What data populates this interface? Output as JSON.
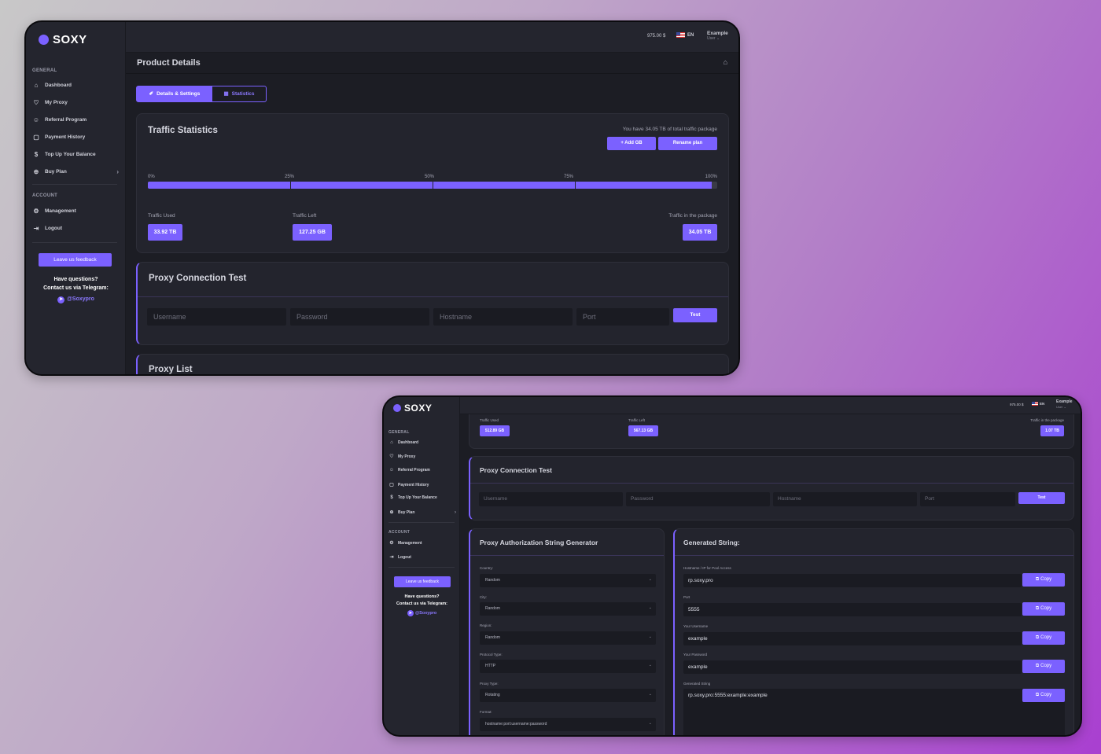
{
  "brand": {
    "name": "SOXY",
    "accent": "#7b61ff"
  },
  "sidebar": {
    "general_label": "GENERAL",
    "account_label": "ACCOUNT",
    "items": [
      {
        "label": "Dashboard",
        "icon": "home-icon"
      },
      {
        "label": "My Proxy",
        "icon": "shield-icon"
      },
      {
        "label": "Referral Program",
        "icon": "users-icon"
      },
      {
        "label": "Payment History",
        "icon": "receipt-icon"
      },
      {
        "label": "Top Up Your Balance",
        "icon": "dollar-icon"
      },
      {
        "label": "Buy Plan",
        "icon": "globe-icon"
      }
    ],
    "account_items": [
      {
        "label": "Management",
        "icon": "gear-icon"
      },
      {
        "label": "Logout",
        "icon": "logout-icon"
      }
    ],
    "feedback": "Leave us feedback",
    "help_line1": "Have questions?",
    "help_line2": "Contact us via Telegram:",
    "telegram_top": "@Soxypro",
    "telegram_bottom": "@Soxypro"
  },
  "topbar": {
    "balance": "975.00 $",
    "lang": "EN",
    "user_name": "Example",
    "user_role": "User ⌄"
  },
  "win1": {
    "page_title": "Product Details",
    "tabs": [
      "Details & Settings",
      "Statistics"
    ],
    "traffic": {
      "title": "Traffic Statistics",
      "note": "You have 34.05 TB of total traffic package",
      "add_gb": "+ Add GB",
      "rename": "Rename plan",
      "ticks": [
        "0%",
        "25%",
        "50%",
        "75%",
        "100%"
      ],
      "progress_fraction": 0.99,
      "used_label": "Traffic Used",
      "used": "33.92 TB",
      "left_label": "Traffic Left",
      "left": "127.25 GB",
      "package_label": "Traffic in the package",
      "package": "34.05 TB"
    },
    "conn": {
      "title": "Proxy Connection Test",
      "username_ph": "Username",
      "password_ph": "Password",
      "hostname_ph": "Hostname",
      "port_ph": "Port",
      "test": "Test"
    },
    "proxy_list_title": "Proxy List"
  },
  "win2": {
    "used_label": "Traffic Used",
    "used": "512.89 GB",
    "left_label": "Traffic Left",
    "left": "567.13 GB",
    "package_label": "Traffic in the package",
    "package": "1.07 TB",
    "conn": {
      "title": "Proxy Connection Test",
      "username_ph": "Username",
      "password_ph": "Password",
      "hostname_ph": "Hostname",
      "port_ph": "Port",
      "test": "Test"
    },
    "gen": {
      "title": "Proxy Authorization String Generator",
      "fields": [
        {
          "label": "Country:",
          "value": "Random"
        },
        {
          "label": "City:",
          "value": "Random"
        },
        {
          "label": "Region:",
          "value": "Random"
        },
        {
          "label": "Protocol Type:",
          "value": "HTTP"
        },
        {
          "label": "Proxy Type:",
          "value": "Rotating"
        },
        {
          "label": "Format:",
          "value": "hostname:port:username:password"
        }
      ]
    },
    "out": {
      "title": "Generated String:",
      "copy": "Copy",
      "rows": [
        {
          "label": "Hostname / IP for Pool Access",
          "value": "rp.soxy.pro"
        },
        {
          "label": "Port",
          "value": "5555"
        },
        {
          "label": "Your Username",
          "value": "example"
        },
        {
          "label": "Your Password",
          "value": "example"
        },
        {
          "label": "Generated String",
          "value": "rp.soxy.pro:5555:example:example"
        }
      ]
    }
  }
}
